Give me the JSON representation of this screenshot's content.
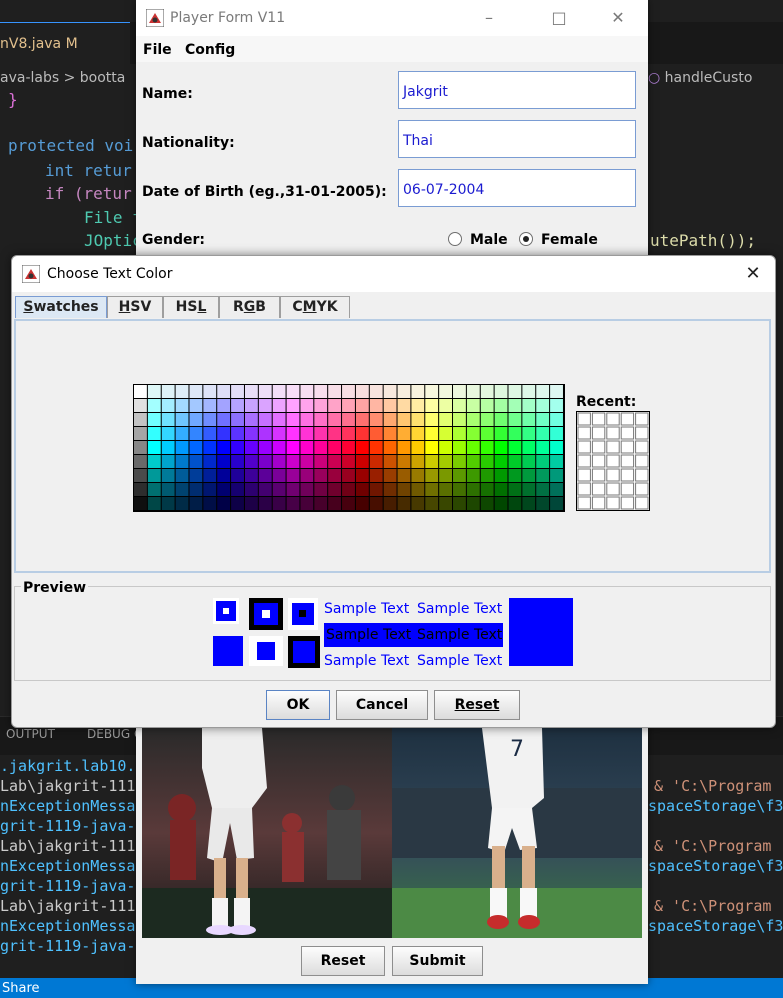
{
  "editor": {
    "tab_label": "nV8.java  M",
    "breadcrumb": "ava-labs  >  bootta",
    "breadcrumb_right": "handleCusto",
    "code_lines": [
      "}",
      "protected voi",
      "int retur",
      "if (retur",
      "File f",
      "JOptic"
    ],
    "code_right": "utePath());",
    "panel_tabs": [
      "OUTPUT",
      "DEBUG C"
    ],
    "terminal_left": [
      ".jakgrit.lab10.",
      "Lab\\jakgrit-111",
      "nExceptionMessa",
      "grit-1119-java-",
      "Lab\\jakgrit-111",
      "nExceptionMessa",
      "grit-1119-java-",
      "Lab\\jakgrit-111",
      "nExceptionMessa",
      "grit-1119-java-"
    ],
    "terminal_right": [
      "& 'C:\\Program",
      "spaceStorage\\f3",
      "& 'C:\\Program",
      "spaceStorage\\f3",
      "& 'C:\\Program",
      "spaceStorage\\f3"
    ],
    "status_left": "Share"
  },
  "player_form": {
    "title": "Player Form V11",
    "menu": [
      "File",
      "Config"
    ],
    "name_label": "Name:",
    "name_value": "Jakgrit",
    "nationality_label": "Nationality:",
    "nationality_value": "Thai",
    "dob_label": "Date of Birth (eg.,31-01-2005):",
    "dob_value": "06-07-2004",
    "gender_label": "Gender:",
    "gender_options": [
      "Male",
      "Female"
    ],
    "gender_selected": "Female",
    "buttons": {
      "reset": "Reset",
      "submit": "Submit"
    }
  },
  "color_dialog": {
    "title": "Choose Text Color",
    "tabs": [
      "Swatches",
      "HSV",
      "HSL",
      "RGB",
      "CMYK"
    ],
    "active_tab": "Swatches",
    "recent_label": "Recent:",
    "preview_label": "Preview",
    "sample_text": "Sample Text",
    "selected_color": "#0000ff",
    "buttons": {
      "ok": "OK",
      "cancel": "Cancel",
      "reset": "Reset"
    }
  }
}
